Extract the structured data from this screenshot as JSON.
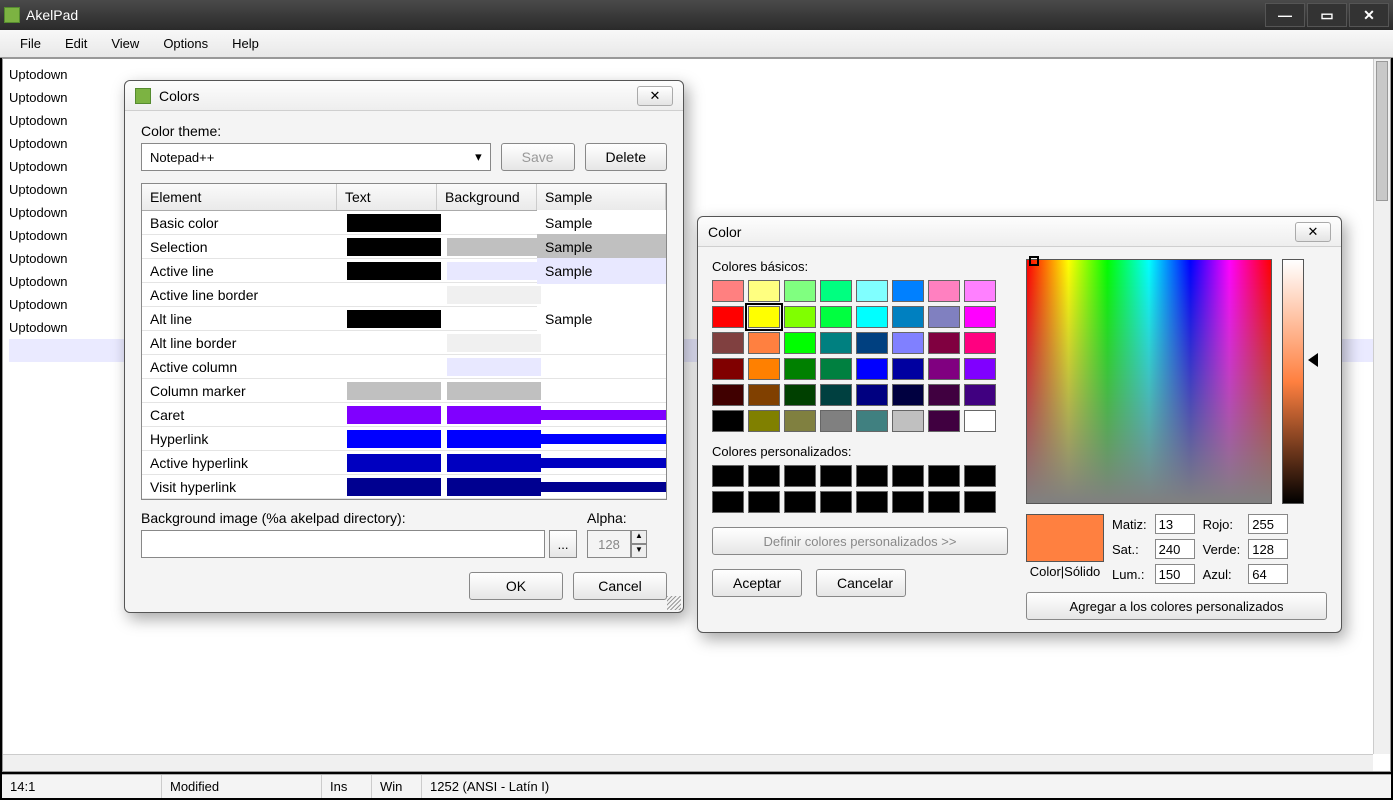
{
  "app": {
    "title": "AkelPad"
  },
  "menu": [
    "File",
    "Edit",
    "View",
    "Options",
    "Help"
  ],
  "editor": {
    "lines": [
      "Uptodown",
      "Uptodown",
      "Uptodown",
      "Uptodown",
      "Uptodown",
      "Uptodown",
      "Uptodown",
      "Uptodown",
      "Uptodown",
      "Uptodown",
      "Uptodown",
      "Uptodown"
    ]
  },
  "status": {
    "pos": "14:1",
    "mod": "Modified",
    "ins": "Ins",
    "enc1": "Win",
    "enc2": "1252  (ANSI - Latín I)"
  },
  "colors": {
    "title": "Colors",
    "theme_label": "Color theme:",
    "theme": "Notepad++",
    "save": "Save",
    "delete": "Delete",
    "headers": {
      "element": "Element",
      "text": "Text",
      "background": "Background",
      "sample": "Sample"
    },
    "rows": [
      {
        "el": "Basic color",
        "text": "#000000",
        "bg": "#ffffff",
        "sample": "Sample",
        "stext": "#000",
        "sbg": "#fff"
      },
      {
        "el": "Selection",
        "text": "#000000",
        "bg": "#c0c0c0",
        "sample": "Sample",
        "stext": "#000",
        "sbg": "#c0c0c0"
      },
      {
        "el": "Active line",
        "text": "#000000",
        "bg": "#e8e8ff",
        "sample": "Sample",
        "stext": "#000",
        "sbg": "#e8e8ff"
      },
      {
        "el": "Active line border",
        "text": "",
        "bg": "#f0f0f0",
        "sample": ""
      },
      {
        "el": "Alt line",
        "text": "#000000",
        "bg": "#ffffff",
        "sample": "Sample",
        "stext": "#000",
        "sbg": "#fff"
      },
      {
        "el": "Alt line border",
        "text": "",
        "bg": "#f0f0f0",
        "sample": ""
      },
      {
        "el": "Active column",
        "text": "",
        "bg": "#e8e8ff",
        "sample": ""
      },
      {
        "el": "Column marker",
        "text": "#c0c0c0",
        "bg": "#c0c0c0",
        "sample": ""
      },
      {
        "el": "Caret",
        "text": "#8000ff",
        "bg": "#8000ff",
        "sample": "",
        "sbg": "#8000ff"
      },
      {
        "el": "Hyperlink",
        "text": "#0000ff",
        "bg": "#0000ff",
        "sample": "",
        "sbg": "#0000ff"
      },
      {
        "el": "Active hyperlink",
        "text": "#0000c0",
        "bg": "#0000c0",
        "sample": "",
        "sbg": "#0000c0"
      },
      {
        "el": "Visit hyperlink",
        "text": "#000090",
        "bg": "#000090",
        "sample": "",
        "sbg": "#000090"
      }
    ],
    "bgimg_label": "Background image (%a akelpad directory):",
    "bgimg": "",
    "alpha_label": "Alpha:",
    "alpha": "128",
    "ok": "OK",
    "cancel": "Cancel"
  },
  "picker": {
    "title": "Color",
    "basic_label": "Colores básicos:",
    "basic": [
      "#ff8080",
      "#ffff80",
      "#80ff80",
      "#00ff80",
      "#80ffff",
      "#0080ff",
      "#ff80c0",
      "#ff80ff",
      "#ff0000",
      "#ffff00",
      "#80ff00",
      "#00ff40",
      "#00ffff",
      "#0080c0",
      "#8080c0",
      "#ff00ff",
      "#804040",
      "#ff8040",
      "#00ff00",
      "#008080",
      "#004080",
      "#8080ff",
      "#800040",
      "#ff0080",
      "#800000",
      "#ff8000",
      "#008000",
      "#008040",
      "#0000ff",
      "#0000a0",
      "#800080",
      "#8000ff",
      "#400000",
      "#804000",
      "#004000",
      "#004040",
      "#000080",
      "#000040",
      "#400040",
      "#400080",
      "#000000",
      "#808000",
      "#808040",
      "#808080",
      "#408080",
      "#c0c0c0",
      "#400040",
      "#ffffff"
    ],
    "selected_index": 9,
    "custom_label": "Colores personalizados:",
    "custom": [
      "#000",
      "#000",
      "#000",
      "#000",
      "#000",
      "#000",
      "#000",
      "#000",
      "#000",
      "#000",
      "#000",
      "#000",
      "#000",
      "#000",
      "#000",
      "#000"
    ],
    "define": "Definir colores personalizados >>",
    "accept": "Aceptar",
    "cancel": "Cancelar",
    "cs_label": "Color|Sólido",
    "preview": "#ff8040",
    "labels": {
      "hue": "Matiz:",
      "sat": "Sat.:",
      "lum": "Lum.:",
      "r": "Rojo:",
      "g": "Verde:",
      "b": "Azul:"
    },
    "values": {
      "hue": "13",
      "sat": "240",
      "lum": "150",
      "r": "255",
      "g": "128",
      "b": "64"
    },
    "add": "Agregar a los colores personalizados"
  }
}
